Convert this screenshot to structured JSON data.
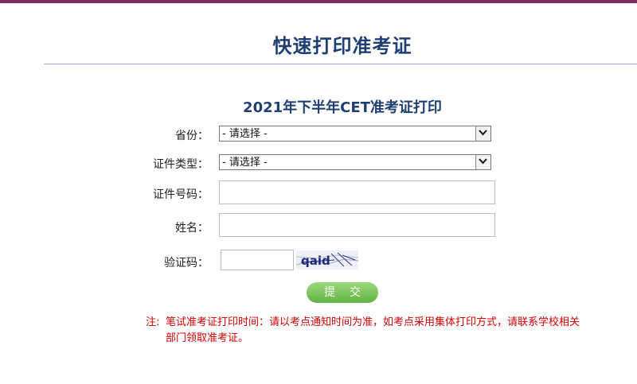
{
  "header": {
    "title": "快速打印准考证"
  },
  "form": {
    "title": "2021年下半年CET准考证打印",
    "province": {
      "label": "省份：",
      "selected": "- 请选择 -"
    },
    "id_type": {
      "label": "证件类型：",
      "selected": "- 请选择 -"
    },
    "id_number": {
      "label": "证件号码：",
      "value": ""
    },
    "name": {
      "label": "姓名：",
      "value": ""
    },
    "captcha": {
      "label": "验证码：",
      "value": "",
      "image_text": "qaid"
    },
    "submit_label": "提交"
  },
  "note": {
    "prefix": "注:",
    "text": "笔试准考证打印时间：请以考点通知时间为准，如考点采用集体打印方式，请联系学校相关部门领取准考证。"
  },
  "colors": {
    "title": "#1f3f73",
    "note": "#d40000",
    "button": "#6cbf4a",
    "topbar": "#7a2a5e",
    "rule": "#c59ad1"
  }
}
